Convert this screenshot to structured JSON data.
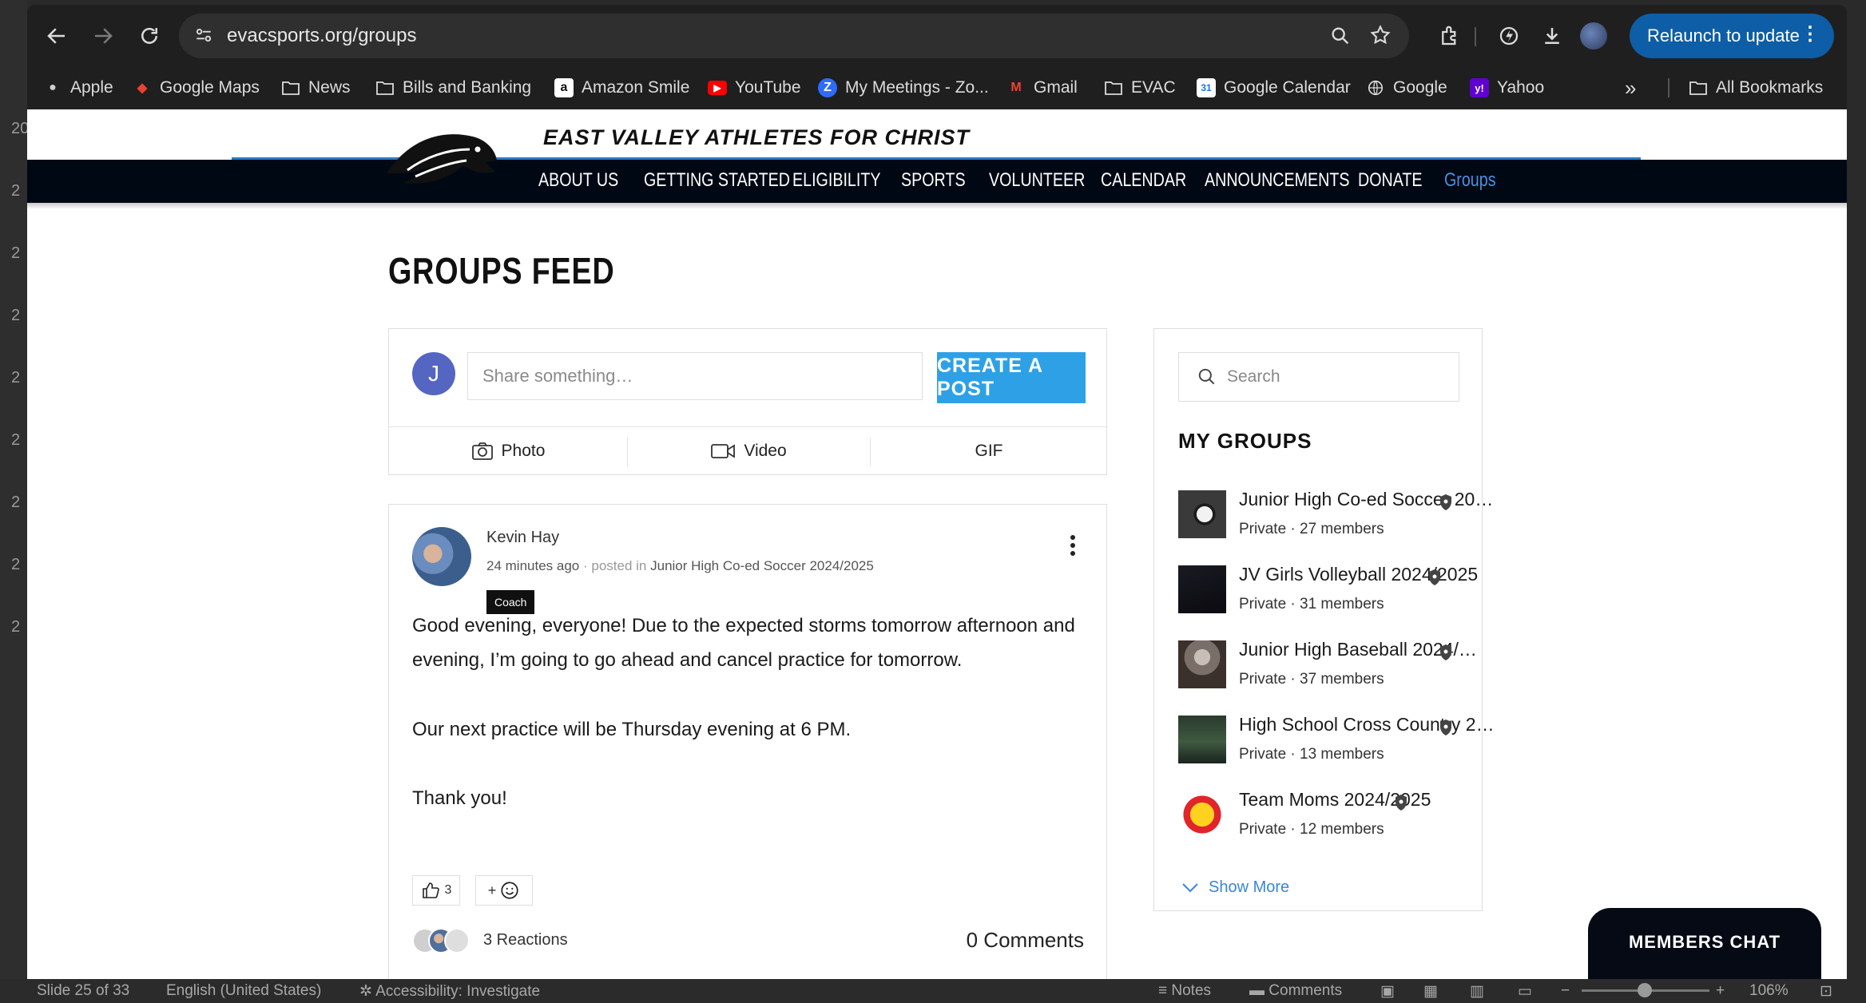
{
  "browser": {
    "url": "evacsports.org/groups",
    "relaunch_label": "Relaunch to update",
    "bookmarks": [
      {
        "label": "Apple",
        "icon": "apple-icon"
      },
      {
        "label": "Google Maps",
        "icon": "google-maps-icon"
      },
      {
        "label": "News",
        "icon": "folder-icon"
      },
      {
        "label": "Bills and Banking",
        "icon": "folder-icon"
      },
      {
        "label": "Amazon Smile",
        "icon": "amazon-icon"
      },
      {
        "label": "YouTube",
        "icon": "youtube-icon"
      },
      {
        "label": "My Meetings - Zo...",
        "icon": "zoom-icon"
      },
      {
        "label": "Gmail",
        "icon": "gmail-icon"
      },
      {
        "label": "EVAC",
        "icon": "folder-icon"
      },
      {
        "label": "Google Calendar",
        "icon": "calendar-icon"
      },
      {
        "label": "Google",
        "icon": "globe-icon"
      },
      {
        "label": "Yahoo",
        "icon": "yahoo-icon"
      }
    ],
    "more_label": "»",
    "all_bookmarks": "All Bookmarks"
  },
  "site": {
    "title": "EAST VALLEY ATHLETES FOR CHRIST",
    "nav": [
      "ABOUT US",
      "GETTING STARTED",
      "ELIGIBILITY",
      "SPORTS",
      "VOLUNTEER",
      "CALENDAR",
      "ANNOUNCEMENTS",
      "DONATE",
      "Groups"
    ],
    "active_nav": "Groups",
    "accent_color": "#2ea1e6",
    "nav_bg": "#000814"
  },
  "feed": {
    "title": "GROUPS FEED",
    "composer": {
      "avatar_initial": "J",
      "placeholder": "Share something…",
      "create_label": "CREATE A POST",
      "photo_label": "Photo",
      "video_label": "Video",
      "gif_label": "GIF"
    },
    "post": {
      "author": "Kevin Hay",
      "time": "24 minutes ago",
      "posted_in_prefix": "· posted in",
      "group": "Junior High Co-ed Soccer 2024/2025",
      "badge": "Coach",
      "paragraphs": [
        "Good evening, everyone! Due to the expected storms tomorrow afternoon and evening, I’m going to go ahead and cancel practice for tomorrow.",
        "Our next practice will be Thursday evening at 6 PM.",
        "Thank you!"
      ],
      "likes": "3",
      "react_plus": "+",
      "reactions_label": "3 Reactions",
      "comments_label": "0 Comments"
    }
  },
  "sidebar": {
    "search_placeholder": "Search",
    "my_groups_title": "MY GROUPS",
    "groups": [
      {
        "name": "Junior High Co-ed Soccer 20…",
        "info": "Private · 27 members"
      },
      {
        "name": "JV Girls Volleyball 2024/2025",
        "info": "Private · 31 members"
      },
      {
        "name": "Junior High Baseball 2024/…",
        "info": "Private · 37 members"
      },
      {
        "name": "High School Cross Country 2…",
        "info": "Private · 13 members"
      },
      {
        "name": "Team Moms 2024/2025",
        "info": "Private · 12 members"
      }
    ],
    "show_more": "Show More"
  },
  "members_chat": "MEMBERS CHAT",
  "statusbar": {
    "slide": "Slide 25 of 33",
    "language": "English (United States)",
    "accessibility": "Accessibility: Investigate",
    "notes": "Notes",
    "comments": "Comments",
    "zoom": "106%"
  }
}
